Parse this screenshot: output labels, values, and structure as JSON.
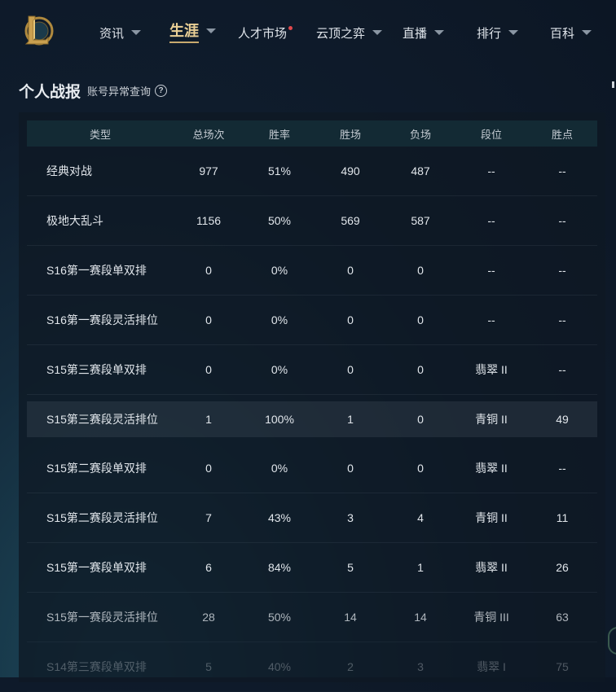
{
  "nav": {
    "items": [
      {
        "label": "资讯",
        "caret": true
      },
      {
        "label": "生涯",
        "caret": true,
        "active": true
      },
      {
        "label": "人才市场",
        "badge": true
      },
      {
        "label": "云顶之弈",
        "caret": true
      },
      {
        "label": "直播",
        "caret": true
      },
      {
        "label": "排行",
        "caret": true
      },
      {
        "label": "百科",
        "caret": true
      }
    ],
    "logo_icon": "league-of-legends-logo"
  },
  "page": {
    "title": "个人战报",
    "check_link": "账号异常查询",
    "help_icon": "?"
  },
  "table": {
    "headers": [
      "类型",
      "总场次",
      "胜率",
      "胜场",
      "负场",
      "段位",
      "胜点"
    ],
    "rows": [
      [
        "经典对战",
        "977",
        "51%",
        "490",
        "487",
        "--",
        "--"
      ],
      [
        "极地大乱斗",
        "1156",
        "50%",
        "569",
        "587",
        "--",
        "--"
      ],
      [
        "S16第一赛段单双排",
        "0",
        "0%",
        "0",
        "0",
        "--",
        "--"
      ],
      [
        "S16第一赛段灵活排位",
        "0",
        "0%",
        "0",
        "0",
        "--",
        "--"
      ],
      [
        "S15第三赛段单双排",
        "0",
        "0%",
        "0",
        "0",
        "翡翠 II",
        "--"
      ],
      [
        "S15第三赛段灵活排位",
        "1",
        "100%",
        "1",
        "0",
        "青铜 II",
        "49"
      ],
      [
        "S15第二赛段单双排",
        "0",
        "0%",
        "0",
        "0",
        "翡翠 II",
        "--"
      ],
      [
        "S15第二赛段灵活排位",
        "7",
        "43%",
        "3",
        "4",
        "青铜 II",
        "11"
      ],
      [
        "S15第一赛段单双排",
        "6",
        "84%",
        "5",
        "1",
        "翡翠 II",
        "26"
      ],
      [
        "S15第一赛段灵活排位",
        "28",
        "50%",
        "14",
        "14",
        "青铜 III",
        "63"
      ],
      [
        "S14第三赛段单双排",
        "5",
        "40%",
        "2",
        "3",
        "翡翠 I",
        "75"
      ]
    ]
  },
  "colors": {
    "accent_gold": "#c8aa6e",
    "badge_red": "#e0484d",
    "header_bg": "#132a34"
  }
}
